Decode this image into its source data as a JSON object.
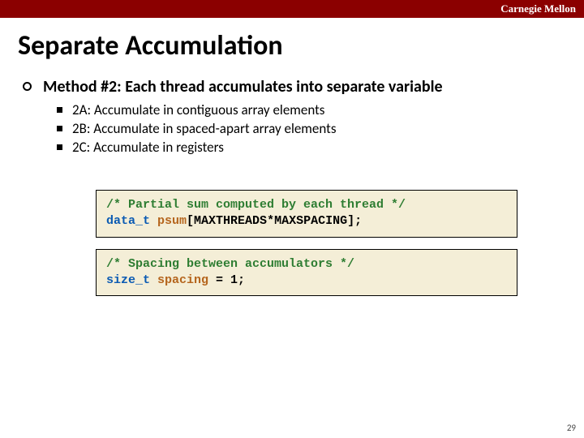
{
  "brand": "Carnegie Mellon",
  "title": "Separate Accumulation",
  "main_point": "Method #2: Each thread accumulates into separate variable",
  "subs": [
    "2A: Accumulate in contiguous array elements",
    "2B: Accumulate in spaced-apart array elements",
    "2C: Accumulate in registers"
  ],
  "code1": {
    "comment": "/* Partial sum computed by each thread */",
    "type": "data_t",
    "var": "psum",
    "rest": "[MAXTHREADS*MAXSPACING];"
  },
  "code2": {
    "comment": "/* Spacing between accumulators */",
    "type": "size_t",
    "var": "spacing",
    "rest": " = 1;"
  },
  "page_number": "29"
}
